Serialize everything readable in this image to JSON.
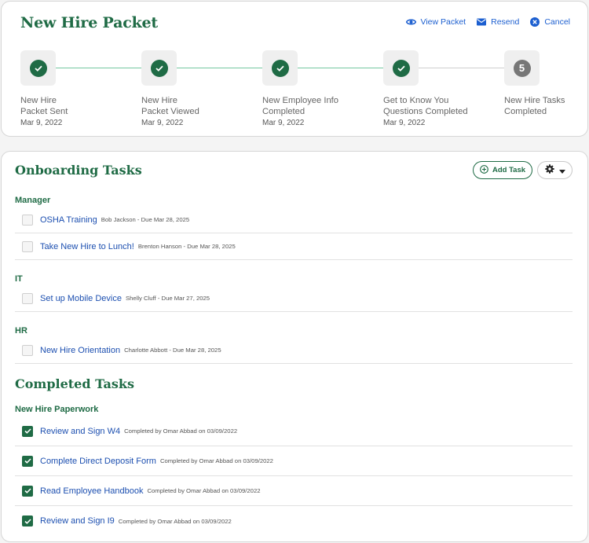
{
  "packet": {
    "title": "New Hire Packet",
    "actions": {
      "view": "View Packet",
      "resend": "Resend",
      "cancel": "Cancel"
    },
    "steps": [
      {
        "line1": "New Hire",
        "line2": "Packet Sent",
        "date": "Mar 9, 2022",
        "status": "complete"
      },
      {
        "line1": "New Hire",
        "line2": "Packet Viewed",
        "date": "Mar 9, 2022",
        "status": "complete"
      },
      {
        "line1": "New Employee Info",
        "line2": "Completed",
        "date": "Mar 9, 2022",
        "status": "complete"
      },
      {
        "line1": "Get to Know You",
        "line2": "Questions Completed",
        "date": "Mar 9, 2022",
        "status": "complete"
      },
      {
        "line1": "New Hire Tasks",
        "line2": "Completed",
        "date": "",
        "status": "pending",
        "number": "5"
      }
    ]
  },
  "onboarding": {
    "title": "Onboarding Tasks",
    "add_task_label": "Add Task",
    "groups": [
      {
        "name": "Manager",
        "tasks": [
          {
            "name": "OSHA Training",
            "meta": "Bob Jackson - Due Mar 28, 2025"
          },
          {
            "name": "Take New Hire to Lunch!",
            "meta": "Brenton Hanson - Due Mar 28, 2025"
          }
        ]
      },
      {
        "name": "IT",
        "tasks": [
          {
            "name": "Set up Mobile Device",
            "meta": "Shelly Cluff - Due Mar 27, 2025"
          }
        ]
      },
      {
        "name": "HR",
        "tasks": [
          {
            "name": "New Hire Orientation",
            "meta": "Charlotte Abbott - Due Mar 28, 2025"
          }
        ]
      }
    ]
  },
  "completed": {
    "title": "Completed Tasks",
    "group": "New Hire Paperwork",
    "tasks": [
      {
        "name": "Review and Sign W4",
        "meta": "Completed by Omar Abbad on 03/09/2022"
      },
      {
        "name": "Complete Direct Deposit Form",
        "meta": "Completed by Omar Abbad on 03/09/2022"
      },
      {
        "name": "Read Employee Handbook",
        "meta": "Completed by Omar Abbad on 03/09/2022"
      },
      {
        "name": "Review and Sign I9",
        "meta": "Completed by Omar Abbad on 03/09/2022"
      }
    ]
  },
  "colors": {
    "brand_green": "#1f6b45",
    "link_blue": "#1c5fd0",
    "connector_green": "#74c7a0"
  }
}
